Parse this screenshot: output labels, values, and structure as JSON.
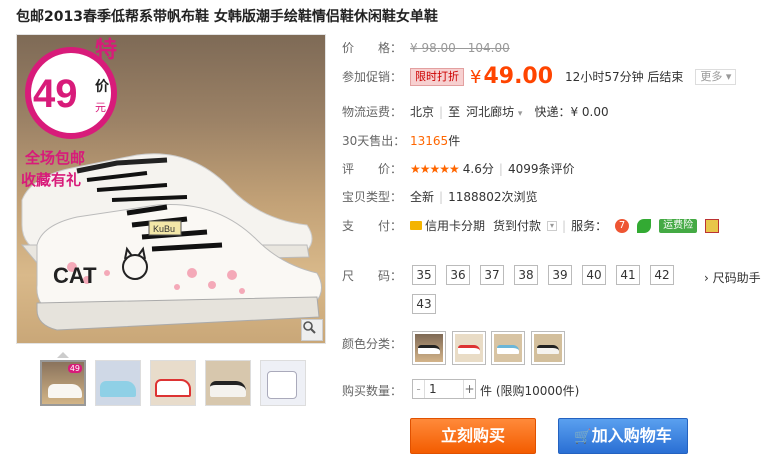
{
  "product": {
    "title": "包邮2013春季低帮系带帆布鞋 女韩版潮手绘鞋情侣鞋休闲鞋女单鞋"
  },
  "badge": {
    "special": "特",
    "price": "49",
    "unit_top": "价",
    "unit_bottom": "元",
    "free_shipping": "全场包邮",
    "favorite": "收藏有礼"
  },
  "shoe_print": {
    "brand": "KuBu",
    "word": "CAT"
  },
  "price_row": {
    "label": "价　　格：",
    "original": "¥ 98.00 - 104.00"
  },
  "promo_row": {
    "label": "参加促销：",
    "tag": "限时打折",
    "currency": "¥",
    "price": "49.00",
    "countdown": "12小时57分钟 后结束",
    "more": "更多"
  },
  "shipping_row": {
    "label": "物流运费：",
    "from": "北京",
    "to_word": "至",
    "to": "河北廊坊",
    "express": "快递：¥ 0.00"
  },
  "sales_row": {
    "label": "30天售出：",
    "count": "13165",
    "unit": "件"
  },
  "rating_row": {
    "label": "评　　价：",
    "stars": "★★★★★",
    "score": "4.6分",
    "reviews": "4099条评价"
  },
  "type_row": {
    "label": "宝贝类型：",
    "type": "全新",
    "views": "1188802次浏览"
  },
  "pay_row": {
    "label": "支　　付：",
    "credit": "信用卡分期",
    "cod": "货到付款",
    "service_label": "服务：",
    "service_7": "7",
    "insurance": "运费险"
  },
  "size_row": {
    "label": "尺　　码：",
    "sizes": [
      "35",
      "36",
      "37",
      "38",
      "39",
      "40",
      "41",
      "42",
      "43"
    ],
    "helper": "› 尺码助手"
  },
  "color_row": {
    "label": "颜色分类："
  },
  "qty_row": {
    "label": "购买数量：",
    "value": "1",
    "minus": "-",
    "plus": "+",
    "limit": "件 (限购10000件)"
  },
  "actions": {
    "buy_now": "立刻购买",
    "add_cart": "加入购物车"
  },
  "thumb_badge": "49",
  "colors": {
    "accent_orange": "#f40",
    "buy_button": "#f35c00",
    "cart_button": "#2a6fd4",
    "promo_badge": "#d81b7a"
  }
}
